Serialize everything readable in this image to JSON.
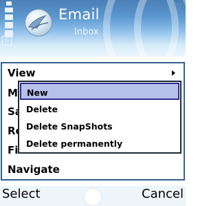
{
  "app": {
    "title": "Email",
    "subtitle": "Inbox",
    "mode_indicator": "G",
    "top_right_indicator": "(*)"
  },
  "options_menu": {
    "items": [
      {
        "label": "View",
        "has_submenu": true
      },
      {
        "label": "M"
      },
      {
        "label": "Sa"
      },
      {
        "label": "Re"
      },
      {
        "label": "Fi"
      },
      {
        "label": "Navigate"
      }
    ]
  },
  "submenu": {
    "items": [
      {
        "label": "New",
        "selected": true
      },
      {
        "label": "Delete"
      },
      {
        "label": "Delete SnapShots"
      },
      {
        "label": "Delete permanently"
      }
    ]
  },
  "softkeys": {
    "left": "Select",
    "right": "Cancel"
  },
  "colors": {
    "title_pane_top": "#4a7fb7",
    "menu_border": "#2f5f8f",
    "selection_fill": "#b7c0ea",
    "selection_border": "#2e2e8f"
  }
}
